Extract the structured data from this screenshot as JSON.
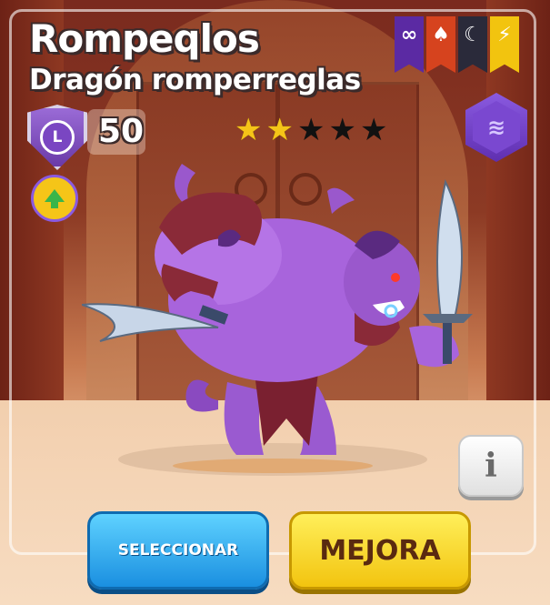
{
  "dragon": {
    "name": "Rompeqlos",
    "title": "Dragón romperreglas",
    "level": "50",
    "rank_letter": "L",
    "stars_filled": 2,
    "stars_total": 5
  },
  "elements": [
    {
      "name": "infinity-element-icon",
      "glyph": "∞",
      "color": "#5b2aa3"
    },
    {
      "name": "war-element-icon",
      "glyph": "♠",
      "color": "#d6431e"
    },
    {
      "name": "dark-element-icon",
      "glyph": "☾",
      "color": "#2a2a3a"
    },
    {
      "name": "electric-element-icon",
      "glyph": "⚡",
      "color": "#f2c40f"
    }
  ],
  "stars": [
    "★",
    "★",
    "★",
    "★",
    "★"
  ],
  "rank_icon": "≋",
  "info_label": "i",
  "buttons": {
    "select": "SELECCIONAR",
    "upgrade": "MEJORA"
  },
  "colors": {
    "select_button": "#1a8fe0",
    "upgrade_button": "#f2c40f",
    "star_filled": "#f5c518",
    "rank_purple": "#7a46c2"
  }
}
